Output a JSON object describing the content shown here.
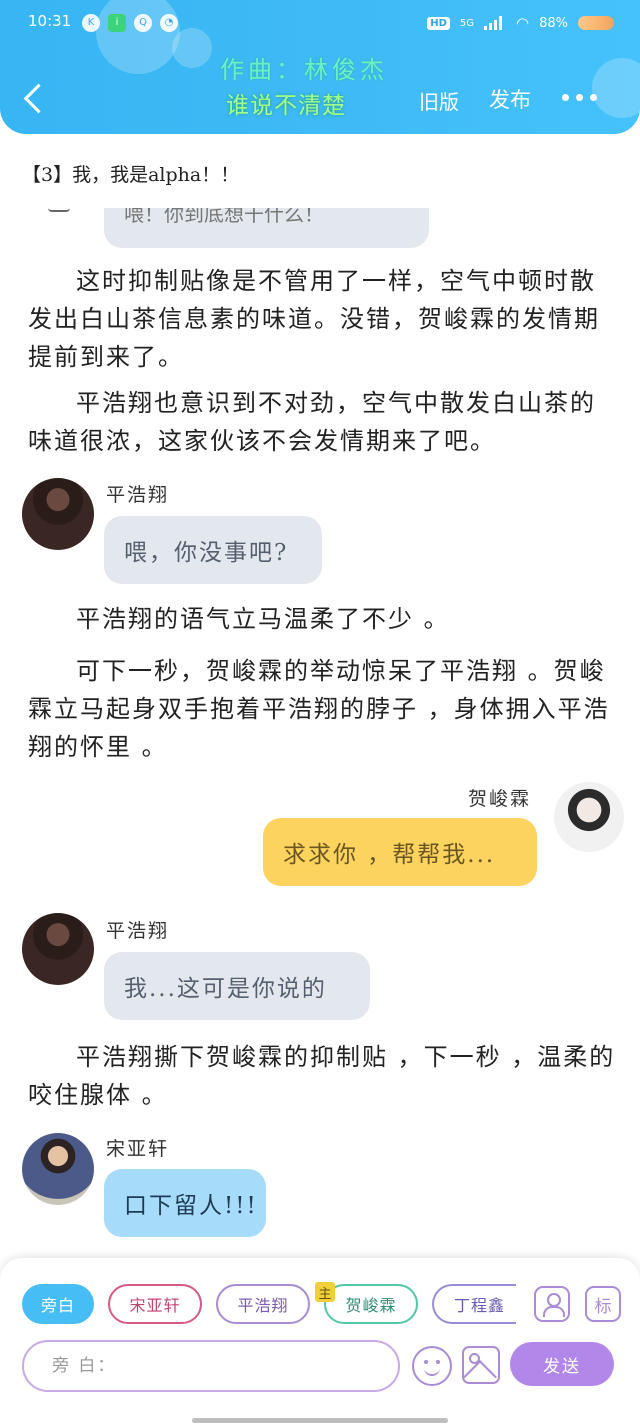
{
  "status_bar": {
    "time": "10:31",
    "network": "5G",
    "hd": "HD",
    "battery": "88%",
    "app_icons": [
      "K",
      "iQIYI",
      "QQ",
      "speed"
    ]
  },
  "header": {
    "author": "作曲：林俊杰",
    "title": "谁说不清楚",
    "old_version": "旧版",
    "publish": "发布"
  },
  "content": {
    "chapter": "【3】我，我是alpha！！",
    "clip_bubble": "喂！你到底想干什么！",
    "paragraphs": [
      "这时抑制贴像是不管用了一样，空气中顿时散发出白山茶信息素的味道。没错，贺峻霖的发情期提前到来了。",
      "平浩翔也意识到不对劲，空气中散发白山茶的味道很浓，这家伙该不会发情期来了吧。",
      "平浩翔的语气立马温柔了不少 。",
      "可下一秒，贺峻霖的举动惊呆了平浩翔 。贺峻霖立马起身双手抱着平浩翔的脖子 ，身体拥入平浩翔的怀里 。",
      "平浩翔撕下贺峻霖的抑制贴 ，下一秒 ，温柔的咬住腺体 。"
    ],
    "messages": [
      {
        "speaker": "平浩翔",
        "text": "喂，你没事吧?"
      },
      {
        "speaker": "贺峻霖",
        "text": "求求你 ，帮帮我..."
      },
      {
        "speaker": "平浩翔",
        "text": "我...这可是你说的"
      },
      {
        "speaker": "宋亚轩",
        "text": "口下留人!!!"
      }
    ]
  },
  "input_panel": {
    "roles": [
      "旁白",
      "宋亚轩",
      "平浩翔",
      "贺峻霖",
      "丁程鑫"
    ],
    "badge": "主",
    "tag_button": "标",
    "input_placeholder": "旁 白：",
    "send_label": "发送"
  },
  "colors": {
    "header_blue": "#3fbaf6",
    "accent_purple": "#b287ea",
    "bubble_gray": "#e3e8ef",
    "bubble_yellow": "#fbd35e",
    "bubble_blue": "#a6dcfa"
  }
}
